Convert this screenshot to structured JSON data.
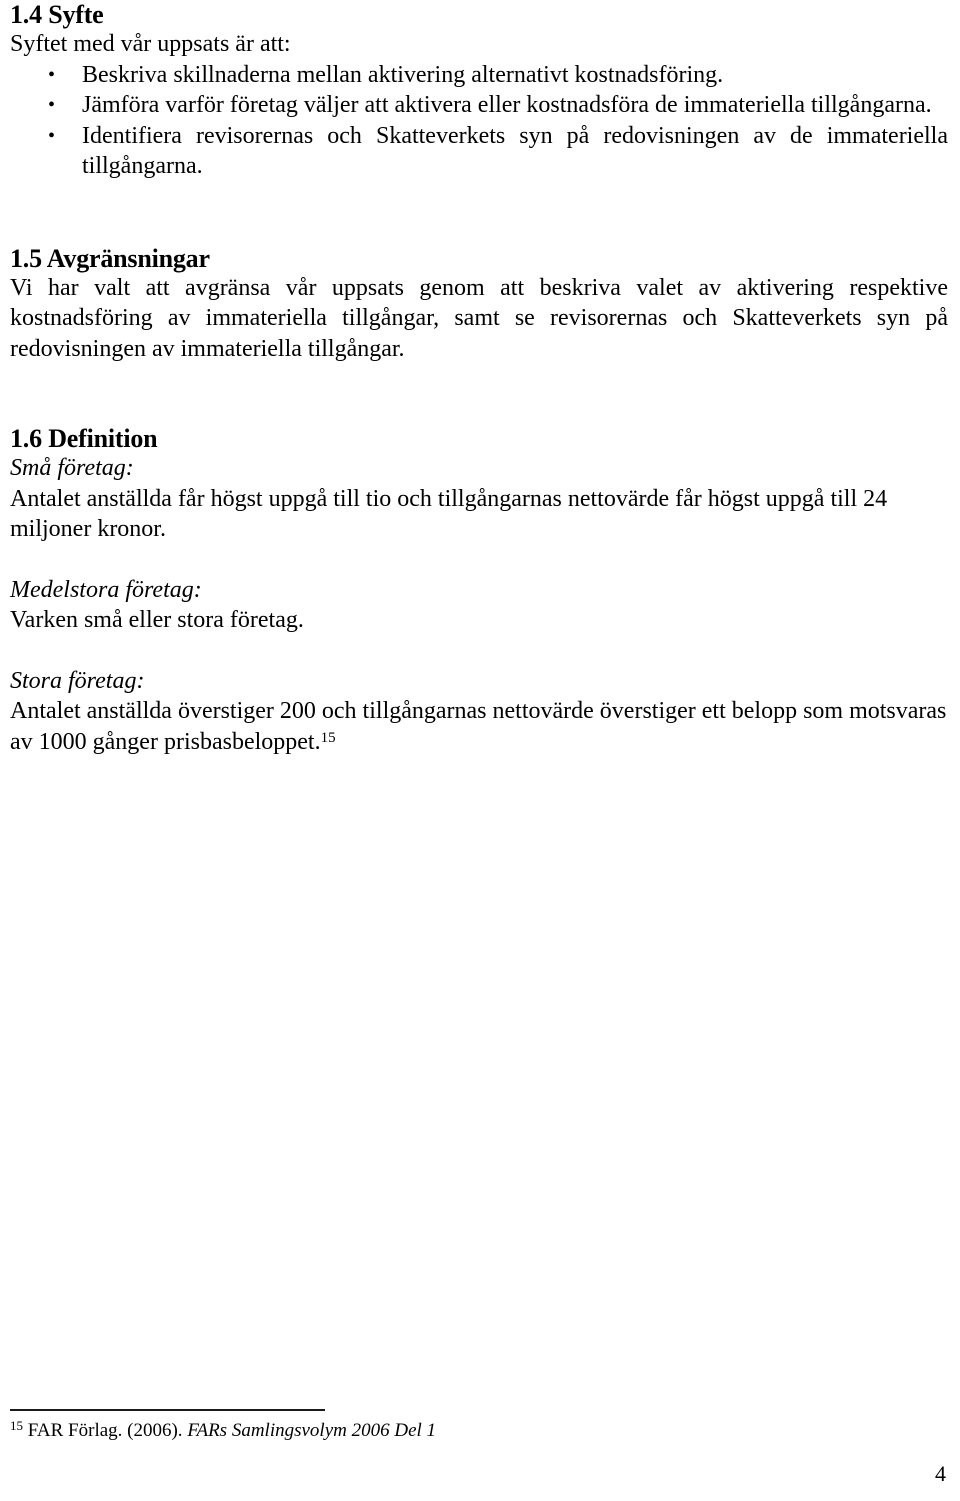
{
  "document": {
    "page_number": "4",
    "language": "sv"
  },
  "sections": {
    "syfte": {
      "heading": "1.4 Syfte",
      "intro": "Syftet med vår uppsats är att:",
      "bullets": [
        "Beskriva skillnaderna mellan aktivering alternativt kostnadsföring.",
        "Jämföra varför företag väljer att aktivera eller kostnadsföra de immateriella tillgångarna.",
        "Identifiera revisorernas och Skatteverkets syn på redovisningen av de immateriella tillgångarna."
      ]
    },
    "avgransningar": {
      "heading": "1.5 Avgränsningar",
      "paragraph": "Vi har valt att avgränsa vår uppsats genom att beskriva valet av aktivering respektive kostnadsföring av immateriella tillgångar, samt se revisorernas och Skatteverkets syn på redovisningen av immateriella tillgångar."
    },
    "definition": {
      "heading": "1.6 Definition",
      "entries": [
        {
          "label": "Små företag:",
          "text": "Antalet anställda får högst uppgå till tio och tillgångarnas nettovärde får högst uppgå till 24 miljoner kronor."
        },
        {
          "label": "Medelstora företag:",
          "text": "Varken små eller stora företag."
        },
        {
          "label": "Stora företag:",
          "text": "Antalet anställda överstiger 200 och tillgångarnas nettovärde överstiger ett belopp som motsvaras av 1000 gånger prisbasbeloppet.",
          "footnote_marker": "15"
        }
      ]
    }
  },
  "footnote": {
    "marker": "15",
    "publisher": "FAR Förlag. (2006).",
    "title": "FARs Samlingsvolym 2006 Del 1"
  }
}
